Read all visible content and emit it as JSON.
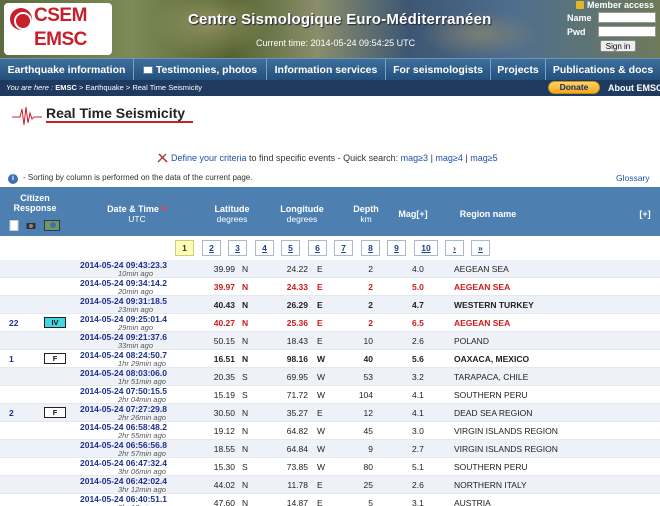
{
  "header": {
    "logo_line1": "CSEM",
    "logo_line2": "EMSC",
    "site_title": "Centre Sismologique Euro-Méditerranéen",
    "current_time": "Current time: 2014-05-24 09:54:25 UTC",
    "member_access_label": "Member access",
    "name_label": "Name",
    "pwd_label": "Pwd",
    "sign_in_label": "Sign in"
  },
  "nav": {
    "items": [
      "Earthquake information",
      "Testimonies, photos",
      "Information services",
      "For seismologists",
      "Projects",
      "Publications & docs"
    ]
  },
  "breadcrumb": {
    "you_are_here": "You are here :",
    "root": "EMSC",
    "sep1": " > Earthquake > Real Time Seismicity"
  },
  "donate_label": "Donate",
  "about_label": "About EMSC",
  "page_title": "Real Time Seismicity",
  "criteria": {
    "link": "Define your criteria",
    "text": " to find specific events - Quick search: ",
    "q1": "mag≥3",
    "q2": "mag≥4",
    "q3": "mag≥5",
    "sep": " | "
  },
  "info_text": "- Sorting by column is performed on the data of the current page.",
  "glossary_label": "Glossary",
  "table_header": {
    "citizen": "Citizen",
    "response": "Response",
    "datetime": "Date & Time",
    "utc": "UTC",
    "latitude": "Latitude",
    "lat_unit": "degrees",
    "longitude": "Longitude",
    "lon_unit": "degrees",
    "depth": "Depth",
    "depth_unit": "km",
    "mag": "Mag[+]",
    "region": "Region name",
    "expand": "[+]"
  },
  "pager": [
    "1",
    "2",
    "3",
    "4",
    "5",
    "6",
    "7",
    "8",
    "9",
    "10",
    "›",
    "»"
  ],
  "rows": [
    {
      "dt": "2014-05-24   09:43:23.3",
      "ago": "10min ago",
      "lat": "39.99",
      "latd": "N",
      "lon": "24.22",
      "lond": "E",
      "dep": "2",
      "mag": "4.0",
      "reg": "AEGEAN SEA",
      "resp": "",
      "badge": "",
      "style": "normal"
    },
    {
      "dt": "2014-05-24   09:34:14.2",
      "ago": "20min ago",
      "lat": "39.97",
      "latd": "N",
      "lon": "24.33",
      "lond": "E",
      "dep": "2",
      "mag": "5.0",
      "reg": "AEGEAN SEA",
      "resp": "",
      "badge": "",
      "style": "red"
    },
    {
      "dt": "2014-05-24   09:31:18.5",
      "ago": "23min ago",
      "lat": "40.43",
      "latd": "N",
      "lon": "26.29",
      "lond": "E",
      "dep": "2",
      "mag": "4.7",
      "reg": "WESTERN TURKEY",
      "resp": "",
      "badge": "",
      "style": "big"
    },
    {
      "dt": "2014-05-24   09:25:01.4",
      "ago": "29min ago",
      "lat": "40.27",
      "latd": "N",
      "lon": "25.36",
      "lond": "E",
      "dep": "2",
      "mag": "6.5",
      "reg": "AEGEAN SEA",
      "resp": "22",
      "badge": "IV",
      "style": "red"
    },
    {
      "dt": "2014-05-24   09:21:37.6",
      "ago": "33min ago",
      "lat": "50.15",
      "latd": "N",
      "lon": "18.43",
      "lond": "E",
      "dep": "10",
      "mag": "2.6",
      "reg": "POLAND",
      "resp": "",
      "badge": "",
      "style": "normal"
    },
    {
      "dt": "2014-05-24   08:24:50.7",
      "ago": "1hr 29min ago",
      "lat": "16.51",
      "latd": "N",
      "lon": "98.16",
      "lond": "W",
      "dep": "40",
      "mag": "5.6",
      "reg": "OAXACA, MEXICO",
      "resp": "1",
      "badge": "F",
      "style": "big"
    },
    {
      "dt": "2014-05-24   08:03:06.0",
      "ago": "1hr 51min ago",
      "lat": "20.35",
      "latd": "S",
      "lon": "69.95",
      "lond": "W",
      "dep": "53",
      "mag": "3.2",
      "reg": "TARAPACA, CHILE",
      "resp": "",
      "badge": "",
      "style": "normal"
    },
    {
      "dt": "2014-05-24   07:50:15.5",
      "ago": "2hr 04min ago",
      "lat": "15.19",
      "latd": "S",
      "lon": "71.72",
      "lond": "W",
      "dep": "104",
      "mag": "4.1",
      "reg": "SOUTHERN PERU",
      "resp": "",
      "badge": "",
      "style": "normal"
    },
    {
      "dt": "2014-05-24   07:27:29.8",
      "ago": "2hr 26min ago",
      "lat": "30.50",
      "latd": "N",
      "lon": "35.27",
      "lond": "E",
      "dep": "12",
      "mag": "4.1",
      "reg": "DEAD SEA REGION",
      "resp": "2",
      "badge": "F",
      "style": "normal"
    },
    {
      "dt": "2014-05-24   06:58:48.2",
      "ago": "2hr 55min ago",
      "lat": "19.12",
      "latd": "N",
      "lon": "64.82",
      "lond": "W",
      "dep": "45",
      "mag": "3.0",
      "reg": "VIRGIN ISLANDS REGION",
      "resp": "",
      "badge": "",
      "style": "normal"
    },
    {
      "dt": "2014-05-24   06:56:56.8",
      "ago": "2hr 57min ago",
      "lat": "18.55",
      "latd": "N",
      "lon": "64.84",
      "lond": "W",
      "dep": "9",
      "mag": "2.7",
      "reg": "VIRGIN ISLANDS REGION",
      "resp": "",
      "badge": "",
      "style": "normal"
    },
    {
      "dt": "2014-05-24   06:47:32.4",
      "ago": "3hr 06min ago",
      "lat": "15.30",
      "latd": "S",
      "lon": "73.85",
      "lond": "W",
      "dep": "80",
      "mag": "5.1",
      "reg": "SOUTHERN PERU",
      "resp": "",
      "badge": "",
      "style": "normal"
    },
    {
      "dt": "2014-05-24   06:42:02.4",
      "ago": "3hr 12min ago",
      "lat": "44.02",
      "latd": "N",
      "lon": "11.78",
      "lond": "E",
      "dep": "25",
      "mag": "2.6",
      "reg": "NORTHERN ITALY",
      "resp": "",
      "badge": "",
      "style": "normal"
    },
    {
      "dt": "2014-05-24   06:40:51.1",
      "ago": "3hr 13min ago",
      "lat": "47.60",
      "latd": "N",
      "lon": "14.87",
      "lond": "E",
      "dep": "5",
      "mag": "3.1",
      "reg": "AUSTRIA",
      "resp": "",
      "badge": "",
      "style": "normal"
    }
  ]
}
